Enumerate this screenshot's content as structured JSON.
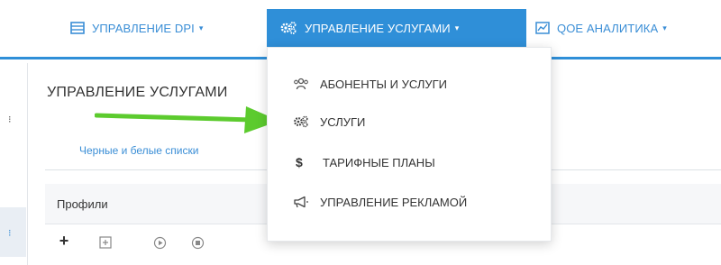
{
  "nav": {
    "dpi_label": "УПРАВЛЕНИЕ DPI",
    "services_label": "УПРАВЛЕНИЕ УСЛУГАМИ",
    "qoe_label": "QOE АНАЛИТИКА",
    "caret": "▾"
  },
  "dropdown": {
    "items": [
      {
        "label": "АБОНЕНТЫ И УСЛУГИ",
        "icon": "users-icon"
      },
      {
        "label": "УСЛУГИ",
        "icon": "cogs-icon"
      },
      {
        "label": "ТАРИФНЫЕ ПЛАНЫ",
        "icon": "dollar-icon"
      },
      {
        "label": "УПРАВЛЕНИЕ РЕКЛАМОЙ",
        "icon": "megaphone-icon"
      }
    ],
    "dollar_glyph": "$"
  },
  "main": {
    "title": "УПРАВЛЕНИЕ УСЛУГАМИ",
    "tab": "Черные и белые списки",
    "section": "Профили",
    "toolbar": {
      "add_glyph": "+"
    }
  },
  "colors": {
    "accent": "#2f8fd8",
    "link": "#3a8ed6",
    "arrow": "#5ccb2e"
  }
}
